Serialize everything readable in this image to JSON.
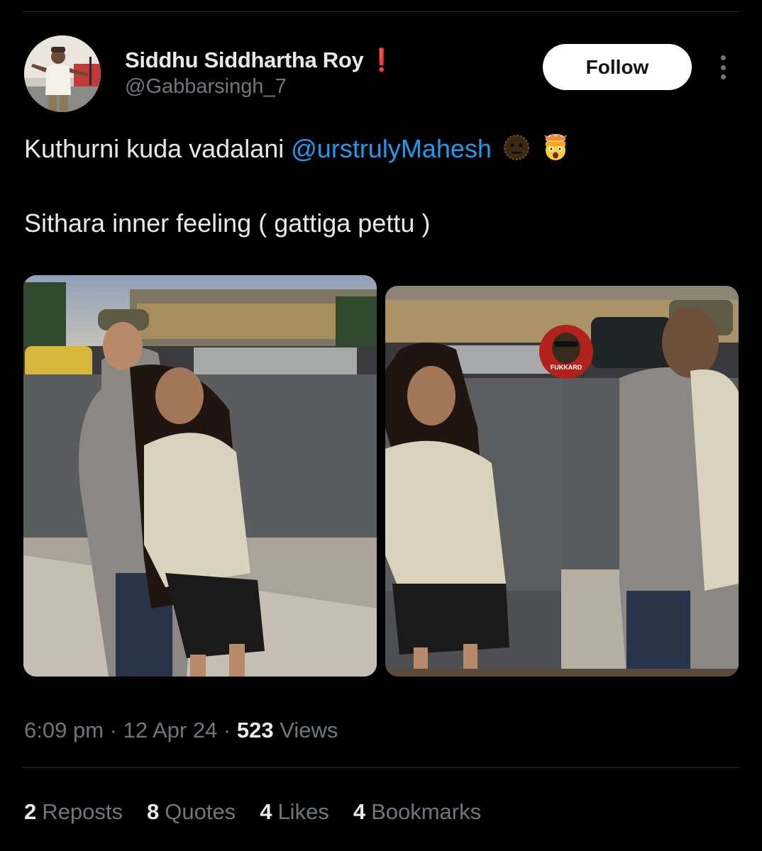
{
  "author": {
    "display_name": "Siddhu Siddhartha Roy",
    "badge": "❗",
    "handle": "@Gabbarsingh_7"
  },
  "follow_label": "Follow",
  "tweet": {
    "line1_text": "Kuthurni kuda vadalani ",
    "mention": "@urstrulyMahesh",
    "emojis": [
      "dark-face-emoji",
      "exploding-head-emoji"
    ],
    "line2_text": "Sithara inner feeling ( gattiga pettu )"
  },
  "media": {
    "watermark_text": "FUKKARD"
  },
  "meta": {
    "time": "6:09 pm",
    "separator": " · ",
    "date": "12 Apr 24",
    "views_count": "523",
    "views_label": " Views"
  },
  "stats": [
    {
      "count": "2",
      "label": "Reposts"
    },
    {
      "count": "8",
      "label": "Quotes"
    },
    {
      "count": "4",
      "label": "Likes"
    },
    {
      "count": "4",
      "label": "Bookmarks"
    }
  ],
  "colors": {
    "background": "#000000",
    "text": "#e7e9ea",
    "muted": "#71767b",
    "link": "#1d9bf0",
    "badge": "#f4212e"
  }
}
